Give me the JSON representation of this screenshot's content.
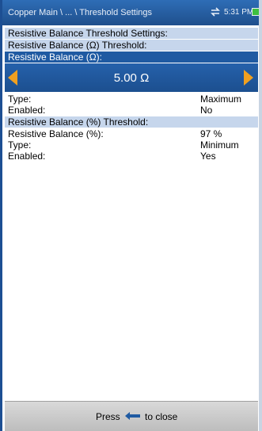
{
  "titlebar": {
    "path": "Copper Main \\ ... \\ Threshold Settings",
    "time": "5:31 PM",
    "sync_icon": "sync-arrows-icon",
    "battery_icon": "battery-icon"
  },
  "settings": {
    "main_header": "Resistive Balance Threshold Settings:",
    "ohm_threshold_header": "Resistive Balance (Ω) Threshold:",
    "ohm_field_label": "Resistive Balance (Ω):",
    "ohm_value": "5.00 Ω",
    "ohm_rows": [
      {
        "label": "Type:",
        "value": "Maximum"
      },
      {
        "label": "Enabled:",
        "value": "No"
      }
    ],
    "percent_threshold_header": "Resistive Balance (%) Threshold:",
    "percent_rows": [
      {
        "label": "Resistive Balance (%):",
        "value": "97 %"
      },
      {
        "label": "Type:",
        "value": "Minimum"
      },
      {
        "label": "Enabled:",
        "value": "Yes"
      }
    ]
  },
  "footer": {
    "press_label": "Press",
    "close_label": "to close",
    "back_icon": "back-arrow-icon"
  },
  "colors": {
    "accent": "#1f5aa2",
    "section_header": "#c6d6ec",
    "arrow": "#f0a020"
  }
}
